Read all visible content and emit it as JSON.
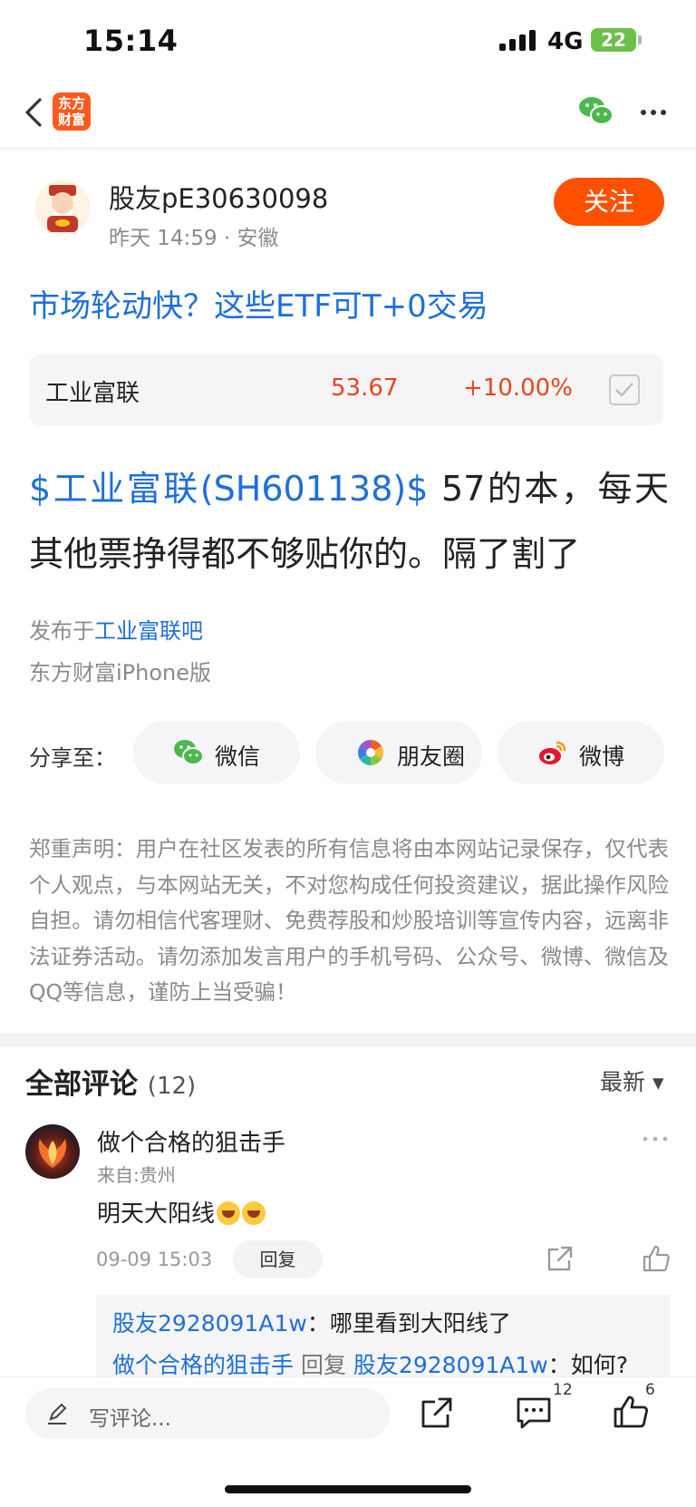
{
  "status_bar": {
    "time": "15:14",
    "network": "4G",
    "battery": "22"
  },
  "nav": {
    "app_logo_line1": "东方",
    "app_logo_line2": "财富"
  },
  "post": {
    "author_name": "股友pE30630098",
    "author_meta": "昨天 14:59 · 安徽",
    "follow_label": "关注",
    "title": "市场轮动快？这些ETF可T+0交易",
    "stock_card": {
      "name": "工业富联",
      "price": "53.67",
      "change": "+10.00%"
    },
    "body_stock_link": "$工业富联(SH601138)$",
    "body_text": " 57的本，每天其他票挣得都不够贴你的。隔了割了",
    "published_prefix": "发布于",
    "published_forum": "工业富联吧",
    "device_source": "东方财富iPhone版"
  },
  "share": {
    "label": "分享至：",
    "buttons": [
      {
        "label": "微信",
        "icon": "wechat-icon"
      },
      {
        "label": "朋友圈",
        "icon": "moments-icon"
      },
      {
        "label": "微博",
        "icon": "weibo-icon"
      }
    ]
  },
  "disclaimer": "郑重声明：用户在社区发表的所有信息将由本网站记录保存，仅代表个人观点，与本网站无关，不对您构成任何投资建议，据此操作风险自担。请勿相信代客理财、免费荐股和炒股培训等宣传内容，远离非法证券活动。请勿添加发言用户的手机号码、公众号、微博、微信及QQ等信息，谨防上当受骗！",
  "comments": {
    "header": "全部评论",
    "count": "(12)",
    "sort_label": "最新 ▾",
    "items": [
      {
        "user": "做个合格的狙击手",
        "location": "来自:贵州",
        "text": "明天大阳线",
        "time": "09-09 15:03",
        "reply_label": "回复",
        "replies": [
          {
            "user": "股友2928091A1w",
            "sep": "：",
            "text": "哪里看到大阳线了"
          },
          {
            "user": "做个合格的狙击手",
            "mid": " 回复 ",
            "target": "股友2928091A1w",
            "sep": "：",
            "text": "如何?"
          }
        ]
      }
    ]
  },
  "bottom_bar": {
    "placeholder": "写评论...",
    "comment_count": "12",
    "like_count": "6"
  },
  "colors": {
    "accent_orange": "#ff5000",
    "link_blue": "#1e6fd9",
    "price_red": "#e8441e"
  }
}
